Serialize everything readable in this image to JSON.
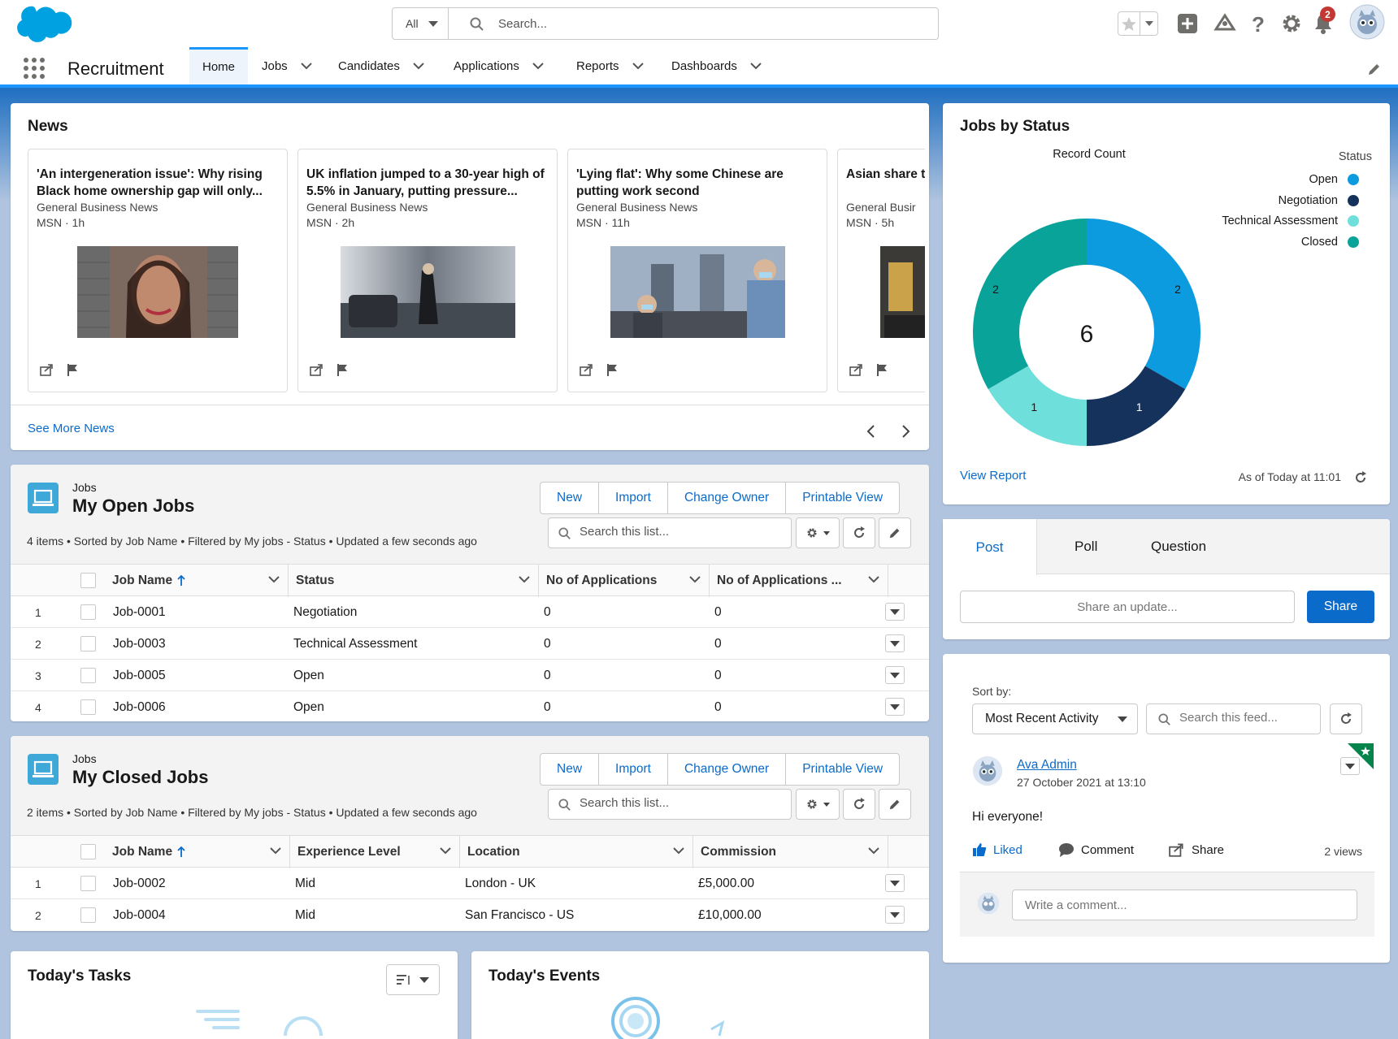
{
  "header": {
    "search_scope": "All",
    "search_placeholder": "Search...",
    "notification_count": "2"
  },
  "nav": {
    "app_name": "Recruitment",
    "tabs": [
      {
        "label": "Home"
      },
      {
        "label": "Jobs"
      },
      {
        "label": "Candidates"
      },
      {
        "label": "Applications"
      },
      {
        "label": "Reports"
      },
      {
        "label": "Dashboards"
      }
    ]
  },
  "news": {
    "title": "News",
    "items": [
      {
        "headline": "'An intergeneration issue': Why rising Black home ownership gap will only...",
        "source": "General Business News",
        "meta": "MSN · 1h"
      },
      {
        "headline": "UK inflation jumped to a 30-year high of 5.5% in January, putting pressure...",
        "source": "General Business News",
        "meta": "MSN · 2h"
      },
      {
        "headline": "'Lying flat': Why some Chinese are putting work second",
        "source": "General Business News",
        "meta": "MSN · 11h"
      },
      {
        "headline": "Asian share tensions, ch",
        "source": "General Busir",
        "meta": "MSN · 5h"
      }
    ],
    "see_more": "See More News"
  },
  "open_jobs": {
    "object_label": "Jobs",
    "title": "My Open Jobs",
    "info": "4 items • Sorted by Job Name • Filtered by My jobs - Status • Updated a few seconds ago",
    "buttons": [
      "New",
      "Import",
      "Change Owner",
      "Printable View"
    ],
    "search_placeholder": "Search this list...",
    "columns": [
      "Job Name",
      "Status",
      "No of Applications",
      "No of Applications ..."
    ],
    "rows": [
      {
        "num": "1",
        "name": "Job-0001",
        "c2": "Negotiation",
        "c3": "0",
        "c4": "0"
      },
      {
        "num": "2",
        "name": "Job-0003",
        "c2": "Technical Assessment",
        "c3": "0",
        "c4": "0"
      },
      {
        "num": "3",
        "name": "Job-0005",
        "c2": "Open",
        "c3": "0",
        "c4": "0"
      },
      {
        "num": "4",
        "name": "Job-0006",
        "c2": "Open",
        "c3": "0",
        "c4": "0"
      }
    ]
  },
  "closed_jobs": {
    "object_label": "Jobs",
    "title": "My Closed Jobs",
    "info": "2 items • Sorted by Job Name • Filtered by My jobs - Status • Updated a few seconds ago",
    "buttons": [
      "New",
      "Import",
      "Change Owner",
      "Printable View"
    ],
    "search_placeholder": "Search this list...",
    "columns": [
      "Job Name",
      "Experience Level",
      "Location",
      "Commission"
    ],
    "rows": [
      {
        "num": "1",
        "name": "Job-0002",
        "c2": "Mid",
        "c3": "London - UK",
        "c4": "£5,000.00"
      },
      {
        "num": "2",
        "name": "Job-0004",
        "c2": "Mid",
        "c3": "San Francisco - US",
        "c4": "£10,000.00"
      }
    ]
  },
  "tasks": {
    "title": "Today's Tasks"
  },
  "events": {
    "title": "Today's Events"
  },
  "jobs_chart": {
    "title": "Jobs by Status",
    "view_report": "View Report",
    "as_of": "As of Today at 11:01"
  },
  "chart_data": {
    "type": "donut",
    "title": "Record Count",
    "legend_title": "Status",
    "legend_position": "right",
    "total": "6",
    "slices": [
      {
        "label": "Open",
        "value": 2,
        "color": "#0b9bde"
      },
      {
        "label": "Negotiation",
        "value": 1,
        "color": "#15325c"
      },
      {
        "label": "Technical Assessment",
        "value": 1,
        "color": "#6edfdb"
      },
      {
        "label": "Closed",
        "value": 2,
        "color": "#0aa39a"
      }
    ]
  },
  "publisher": {
    "tabs": [
      "Post",
      "Poll",
      "Question"
    ],
    "placeholder": "Share an update...",
    "share_button": "Share"
  },
  "feed": {
    "sort_label": "Sort by:",
    "sort_value": "Most Recent Activity",
    "search_placeholder": "Search this feed...",
    "post": {
      "author": "Ava Admin",
      "date": "27 October 2021 at 13:10",
      "body": "Hi everyone!",
      "liked": "Liked",
      "comment": "Comment",
      "share": "Share",
      "views": "2 views"
    },
    "comment_placeholder": "Write a comment..."
  }
}
